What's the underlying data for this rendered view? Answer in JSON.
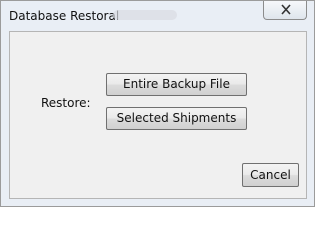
{
  "window": {
    "title": "Database Restoral",
    "close_icon": "close-icon"
  },
  "dialog": {
    "restore_label": "Restore:",
    "entire_backup_label": "Entire Backup File",
    "selected_shipments_label": "Selected Shipments",
    "cancel_label": "Cancel"
  },
  "colors": {
    "window_frame": "#e9eef5",
    "client_background": "#f0f0f0",
    "button_border": "#707070"
  }
}
